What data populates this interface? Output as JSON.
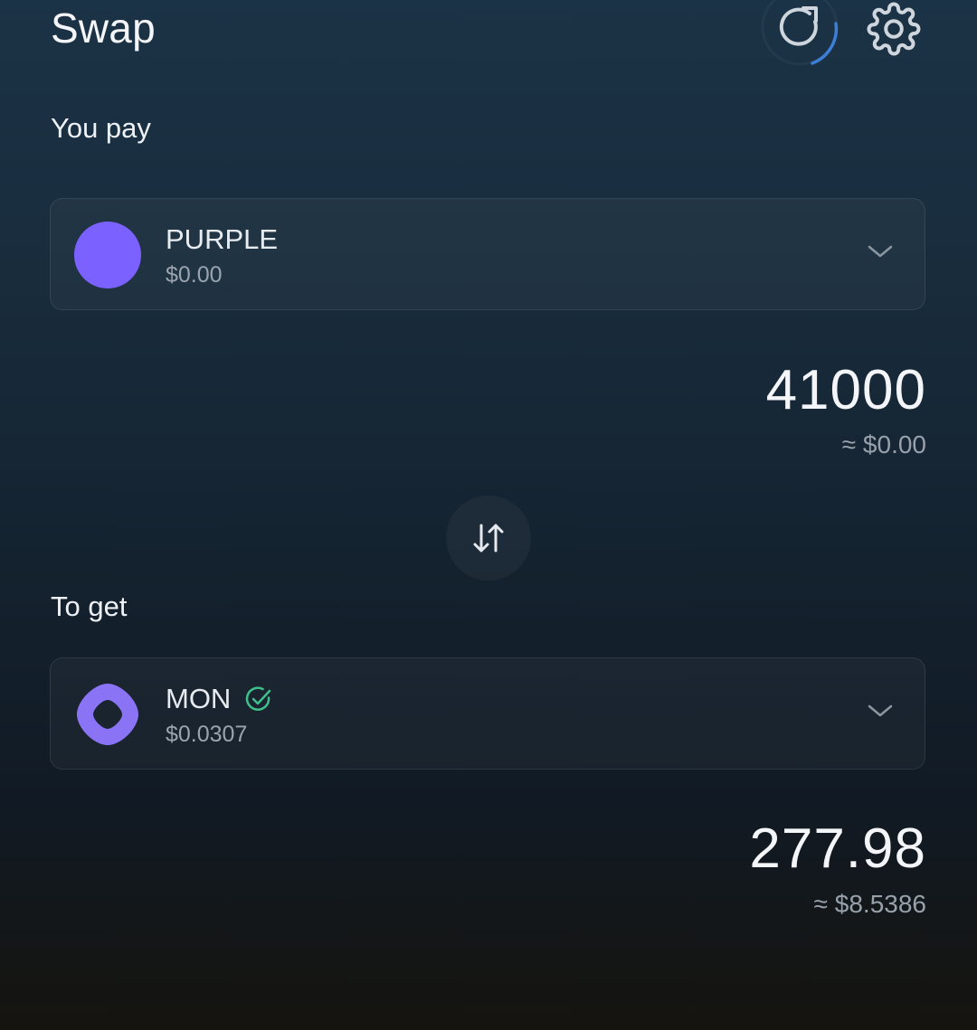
{
  "header": {
    "title": "Swap"
  },
  "pay": {
    "label": "You pay",
    "token": {
      "symbol": "PURPLE",
      "price": "$0.00",
      "logo_color": "#7b61ff"
    },
    "amount": "41000",
    "usd_value": "≈ $0.00"
  },
  "receive": {
    "label": "To get",
    "token": {
      "symbol": "MON",
      "price": "$0.0307",
      "logo_color": "#8a74f5",
      "verified_color": "#3fbf8a"
    },
    "amount": "277.98",
    "usd_value": "≈ $8.5386"
  },
  "icons": {
    "refresh": "refresh-icon",
    "settings": "gear-icon",
    "switch": "swap-arrows-icon",
    "chevron": "chevron-down-icon",
    "verified": "check-circle-icon"
  },
  "colors": {
    "accent_ring": "#3d7fd6",
    "text_muted": "#98a1ab"
  }
}
